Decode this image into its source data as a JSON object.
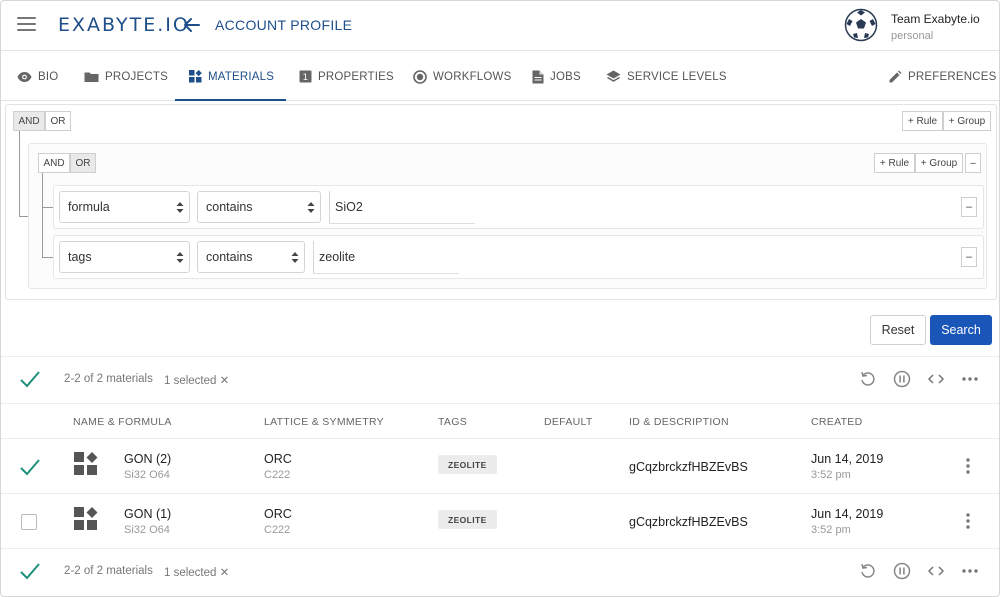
{
  "header": {
    "logo": "EXABYTE.IO",
    "page_title": "ACCOUNT PROFILE",
    "team_name": "Team Exabyte.io",
    "team_type": "personal"
  },
  "tabs": [
    {
      "label": "BIO",
      "icon": "eye-icon"
    },
    {
      "label": "PROJECTS",
      "icon": "folder-icon"
    },
    {
      "label": "MATERIALS",
      "icon": "materials-icon",
      "active": true
    },
    {
      "label": "PROPERTIES",
      "icon": "properties-icon"
    },
    {
      "label": "WORKFLOWS",
      "icon": "workflows-icon"
    },
    {
      "label": "JOBS",
      "icon": "file-icon"
    },
    {
      "label": "SERVICE LEVELS",
      "icon": "layers-icon"
    },
    {
      "label": "PREFERENCES",
      "icon": "pencil-icon"
    }
  ],
  "query": {
    "outer": {
      "and": "AND",
      "or": "OR",
      "add_rule": "+ Rule",
      "add_group": "+ Group"
    },
    "inner": {
      "and": "AND",
      "or": "OR",
      "add_rule": "+ Rule",
      "add_group": "+ Group",
      "remove": "–"
    },
    "rules": [
      {
        "field": "formula",
        "operator": "contains",
        "value": "SiO2",
        "remove": "–"
      },
      {
        "field": "tags",
        "operator": "contains",
        "value": "zeolite",
        "remove": "–"
      }
    ]
  },
  "actions": {
    "reset": "Reset",
    "search": "Search"
  },
  "list": {
    "count_text": "2-2 of 2 materials",
    "selected_text": "1 selected ✕",
    "columns": [
      "NAME & FORMULA",
      "LATTICE & SYMMETRY",
      "TAGS",
      "DEFAULT",
      "ID & DESCRIPTION",
      "CREATED"
    ],
    "rows": [
      {
        "checked": true,
        "name": "GON (2)",
        "formula": "Si32 O64",
        "lattice": "ORC",
        "symmetry": "C222",
        "tag": "ZEOLITE",
        "id": "gCqzbrckzfHBZEvBS",
        "date": "Jun 14, 2019",
        "time": "3:52 pm"
      },
      {
        "checked": false,
        "name": "GON (1)",
        "formula": "Si32 O64",
        "lattice": "ORC",
        "symmetry": "C222",
        "tag": "ZEOLITE",
        "id": "gCqzbrckzfHBZEvBS",
        "date": "Jun 14, 2019",
        "time": "3:52 pm"
      }
    ]
  },
  "colors": {
    "brand": "#1e4f8a",
    "primary_button": "#1a56b8",
    "check": "#1d8f7c"
  }
}
